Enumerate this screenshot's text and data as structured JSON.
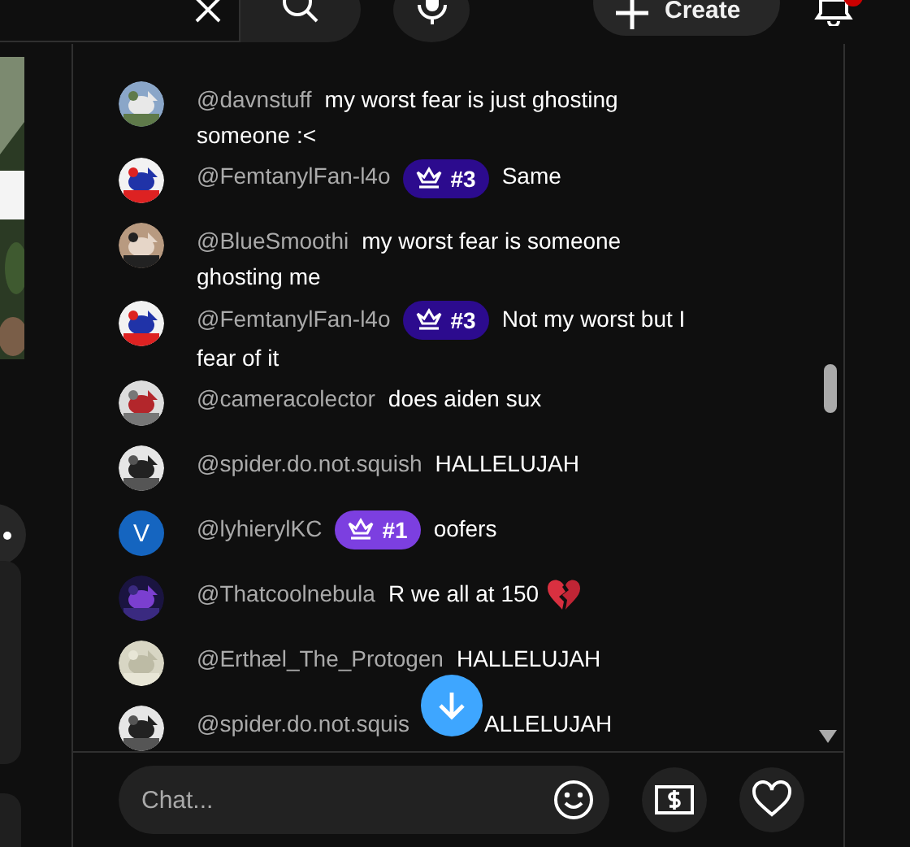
{
  "top_bar": {
    "create_label": "Create"
  },
  "chat": {
    "messages": [
      {
        "author": "@davnstuff",
        "text": "my worst fear is just ghosting someone :<"
      },
      {
        "author": "@FemtanylFan-l4o",
        "badge": {
          "label": "#3",
          "color": "#2c0b8e"
        },
        "text": "Same"
      },
      {
        "author": "@BlueSmoothi",
        "text": "my worst fear is someone ghosting me"
      },
      {
        "author": "@FemtanylFan-l4o",
        "badge": {
          "label": "#3",
          "color": "#2c0b8e"
        },
        "text": "Not my worst but I fear of it"
      },
      {
        "author": "@cameracolector",
        "text": "does aiden sux"
      },
      {
        "author": "@spider.do.not.squish",
        "text": "HALLELUJAH"
      },
      {
        "author": "@lyhierylKC",
        "badge": {
          "label": "#1",
          "color": "#7c3fe0"
        },
        "text": "oofers",
        "avatar": {
          "kind": "letter",
          "letter": "V"
        }
      },
      {
        "author": "@Thatcoolnebula",
        "text": "R we all at 150",
        "broken_heart": true
      },
      {
        "author": "@Erthæl_The_Protogen",
        "text": "HALLELUJAH"
      },
      {
        "author": "@spider.do.not.squis",
        "text": "ALLELUJAH"
      }
    ],
    "input": {
      "placeholder": "Chat..."
    }
  }
}
